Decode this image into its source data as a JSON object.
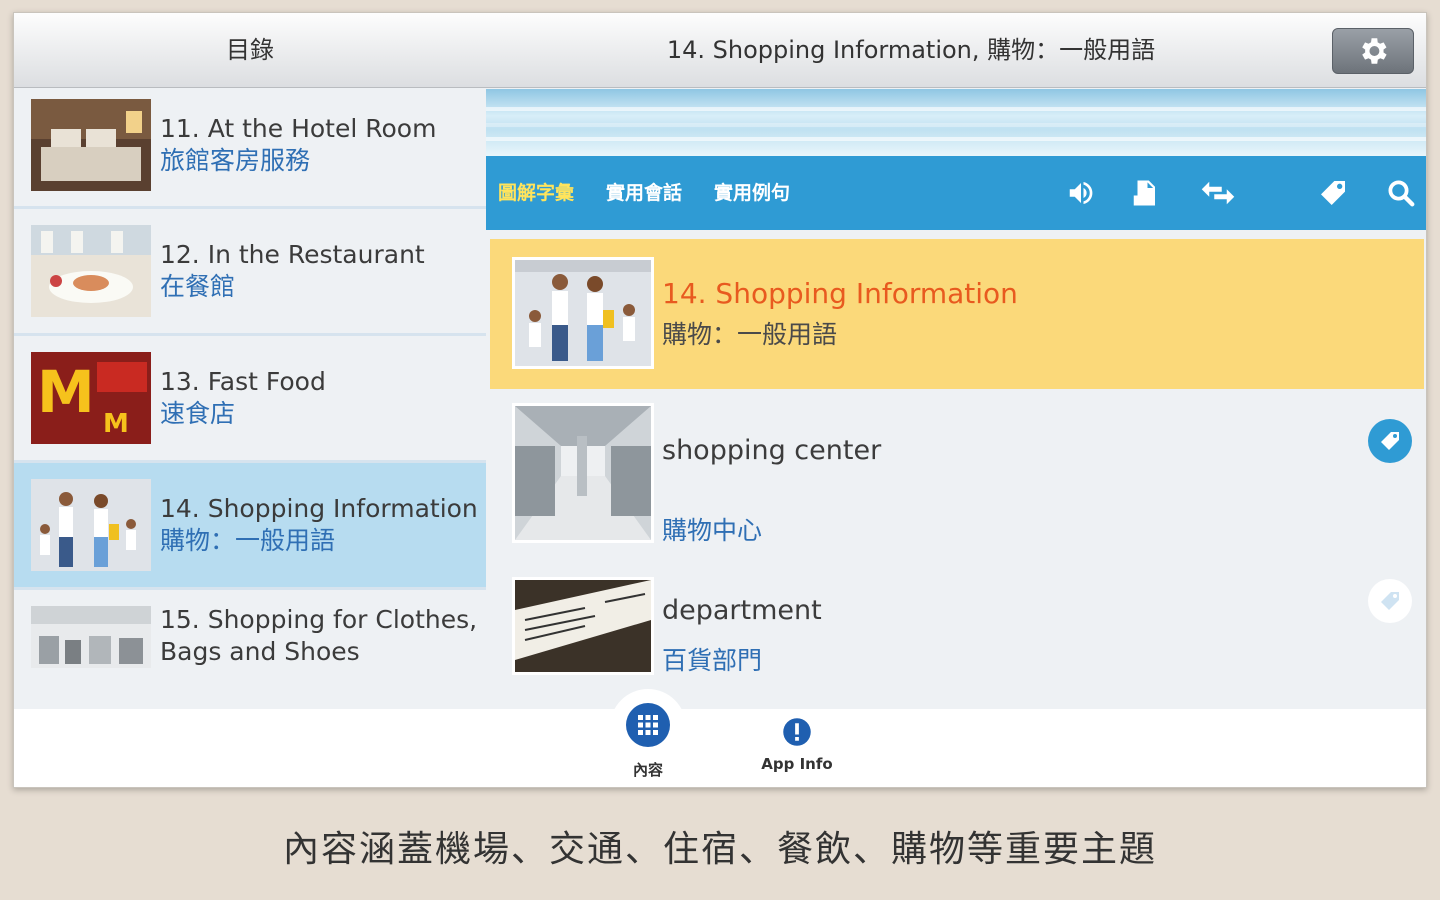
{
  "header": {
    "left_title": "目錄",
    "right_title": "14. Shopping Information, 購物：一般用語",
    "settings_icon": "gear-icon"
  },
  "sidebar": {
    "items": [
      {
        "en": "11. At the Hotel Room",
        "zh": "旅館客房服務"
      },
      {
        "en": "12. In the Restaurant",
        "zh": "在餐館"
      },
      {
        "en": "13. Fast Food",
        "zh": "速食店"
      },
      {
        "en": "14. Shopping Information",
        "zh": "購物：一般用語"
      },
      {
        "en": "15. Shopping for Clothes,",
        "zh": "Bags and Shoes"
      }
    ]
  },
  "toolbar": {
    "tabs": [
      "圖解字彙",
      "實用會話",
      "實用例句"
    ],
    "icons": [
      "speaker-icon",
      "document-icon",
      "repeat-arrows-icon",
      "tag-icon",
      "search-icon"
    ],
    "active_color": "#ffe45c",
    "bar_color": "#2f9bd4"
  },
  "feature": {
    "en": "14. Shopping Information",
    "zh": "購物：一般用語"
  },
  "words": [
    {
      "en": "shopping center",
      "zh": "購物中心",
      "tag_active": true
    },
    {
      "en": "department",
      "zh": "百貨部門",
      "tag_active": false
    }
  ],
  "bottom_nav": {
    "content_label": "內容",
    "info_label": "App Info"
  },
  "caption": "內容涵蓋機場、交通、住宿、餐飲、購物等重要主題"
}
